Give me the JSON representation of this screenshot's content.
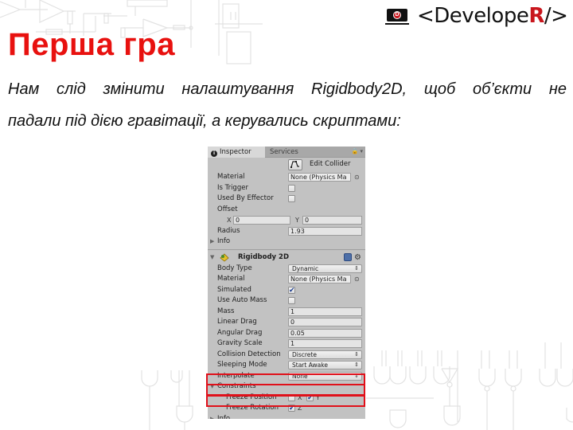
{
  "logo": {
    "icon": "laptop-logo-icon",
    "icon_letter": "D",
    "text_prefix": "<Develope",
    "text_accent": "R",
    "text_suffix": "/>",
    "accent_color": "#c9161d"
  },
  "page": {
    "title": "Перша гра",
    "title_color": "#e8110f",
    "paragraph_line1": "Нам слід змінити налаштування Rigidbody2D, щоб об’єкти не",
    "paragraph_line2": "падали під дією гравітації, а керувались скриптами:"
  },
  "inspector": {
    "tabs": [
      {
        "label": "Inspector",
        "icon": "info-icon",
        "active": true
      },
      {
        "label": "Services",
        "active": false
      }
    ],
    "tab_tools": "lock-icon menu-icon",
    "collider": {
      "edit_collider_label": "Edit Collider",
      "edit_collider_icon": "edit-collider-icon",
      "material_label": "Material",
      "material_value": "None (Physics Ma",
      "is_trigger_label": "Is Trigger",
      "is_trigger": false,
      "used_by_effector_label": "Used By Effector",
      "used_by_effector": false,
      "offset_label": "Offset",
      "offset_x_label": "X",
      "offset_x": "0",
      "offset_y_label": "Y",
      "offset_y": "0",
      "radius_label": "Radius",
      "radius": "1.93",
      "info_label": "Info"
    },
    "rigidbody": {
      "title": "Rigidbody 2D",
      "fields": {
        "body_type_label": "Body Type",
        "body_type": "Dynamic",
        "material_label": "Material",
        "material_value": "None (Physics Ma",
        "simulated_label": "Simulated",
        "simulated": true,
        "use_auto_mass_label": "Use Auto Mass",
        "use_auto_mass": false,
        "mass_label": "Mass",
        "mass": "1",
        "linear_drag_label": "Linear Drag",
        "linear_drag": "0",
        "angular_drag_label": "Angular Drag",
        "angular_drag": "0.05",
        "gravity_scale_label": "Gravity Scale",
        "gravity_scale": "1",
        "collision_detection_label": "Collision Detection",
        "collision_detection": "Discrete",
        "sleeping_mode_label": "Sleeping Mode",
        "sleeping_mode": "Start Awake",
        "interpolate_label": "Interpolate",
        "interpolate": "None"
      },
      "constraints": {
        "label": "Constraints",
        "freeze_position_label": "Freeze Position",
        "freeze_position_x_label": "X",
        "freeze_position_x": false,
        "freeze_position_y_label": "Y",
        "freeze_position_y": true,
        "freeze_rotation_label": "Freeze Rotation",
        "freeze_rotation_z_label": "Z",
        "freeze_rotation_z": true
      },
      "info_label": "Info"
    },
    "highlight_color": "#e0101a"
  },
  "glyphs": {
    "check": "✔",
    "fold_open": "▼",
    "fold_closed": "▶",
    "dropdown_arrows": "⇕",
    "object_picker": "⊙",
    "gear": "⚙",
    "lock_menu": "🔒 ▾"
  }
}
